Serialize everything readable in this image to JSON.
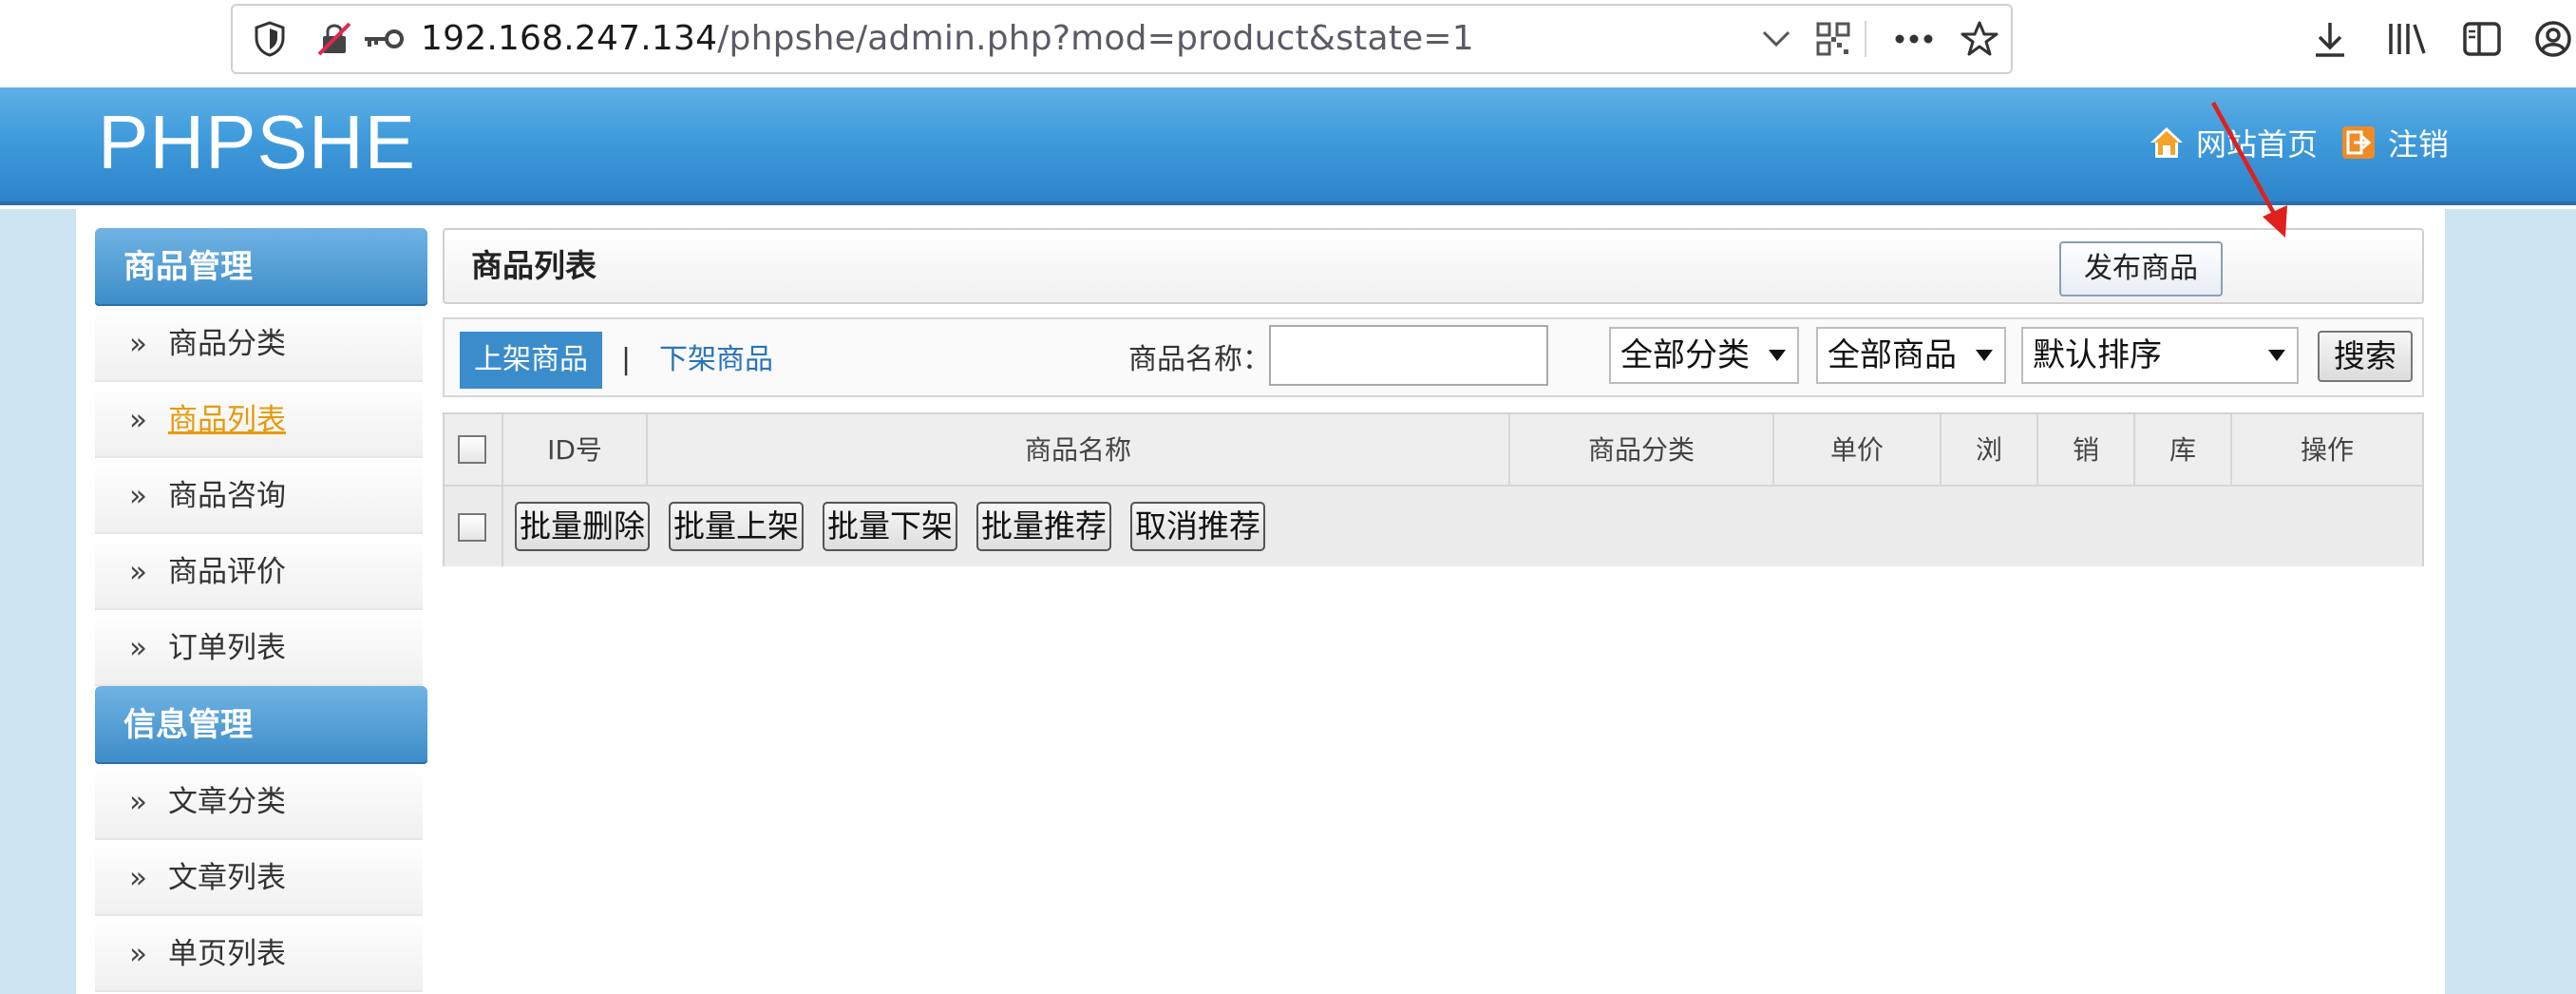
{
  "browser": {
    "url_host": "192.168.247.134",
    "url_path": "/phpshe/admin.php?mod=product&state=1"
  },
  "header": {
    "logo": "PHPSHE",
    "home_link": "网站首页",
    "logout_link": "注销"
  },
  "sidebar": {
    "groups": [
      {
        "title": "商品管理",
        "items": [
          {
            "label": "商品分类"
          },
          {
            "label": "商品列表",
            "active": true
          },
          {
            "label": "商品咨询"
          },
          {
            "label": "商品评价"
          },
          {
            "label": "订单列表"
          }
        ]
      },
      {
        "title": "信息管理",
        "items": [
          {
            "label": "文章分类"
          },
          {
            "label": "文章列表"
          },
          {
            "label": "单页列表"
          }
        ]
      }
    ],
    "chevron": "»"
  },
  "main": {
    "title": "商品列表",
    "publish_button": "发布商品",
    "tabs": {
      "on_shelf": "上架商品",
      "separator": "|",
      "off_shelf": "下架商品"
    },
    "filter": {
      "name_label": "商品名称：",
      "name_value": "",
      "category_select": "全部分类",
      "product_select": "全部商品",
      "sort_select": "默认排序",
      "search_button": "搜索"
    },
    "table": {
      "columns": [
        "ID号",
        "商品名称",
        "商品分类",
        "单价",
        "浏",
        "销",
        "库",
        "操作"
      ]
    },
    "bulk_actions": [
      "批量删除",
      "批量上架",
      "批量下架",
      "批量推荐",
      "取消推荐"
    ]
  },
  "colors": {
    "header_blue": "#3f9bdc",
    "active_link": "#e59b0a",
    "annotation_arrow": "#e0201c"
  }
}
